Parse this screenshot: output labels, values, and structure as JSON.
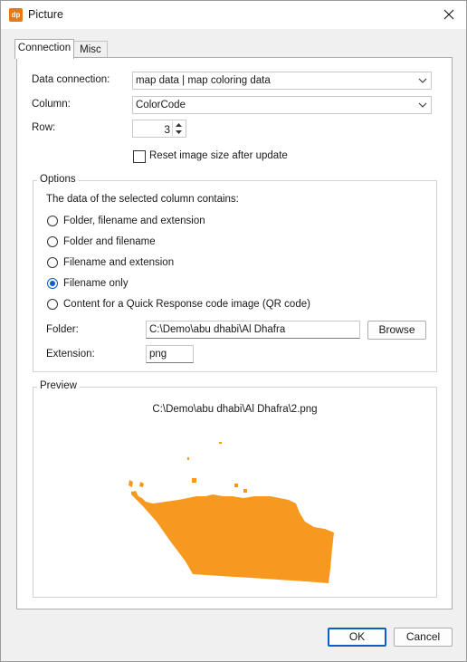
{
  "window": {
    "icon_text": "dp",
    "title": "Picture"
  },
  "tabs": {
    "connection": "Connection",
    "misc": "Misc"
  },
  "connection": {
    "data_connection_label": "Data connection:",
    "data_connection_value": "map data | map coloring data",
    "column_label": "Column:",
    "column_value": "ColorCode",
    "row_label": "Row:",
    "row_value": "3",
    "reset_image_size_label": "Reset image size after update",
    "reset_image_size_checked": false
  },
  "options": {
    "title": "Options",
    "description": "The data of the selected column contains:",
    "radios": [
      {
        "label": "Folder, filename and extension",
        "checked": false
      },
      {
        "label": "Folder and filename",
        "checked": false
      },
      {
        "label": "Filename and extension",
        "checked": false
      },
      {
        "label": "Filename only",
        "checked": true
      },
      {
        "label": "Content for a Quick Response code image (QR code)",
        "checked": false
      }
    ],
    "folder_label": "Folder:",
    "folder_value": "C:\\Demo\\abu dhabi\\Al Dhafra",
    "browse_label": "Browse",
    "extension_label": "Extension:",
    "extension_value": "png"
  },
  "preview": {
    "title": "Preview",
    "path": "C:\\Demo\\abu dhabi\\Al Dhafra\\2.png",
    "shape_color": "#f7991f"
  },
  "buttons": {
    "ok": "OK",
    "cancel": "Cancel"
  }
}
